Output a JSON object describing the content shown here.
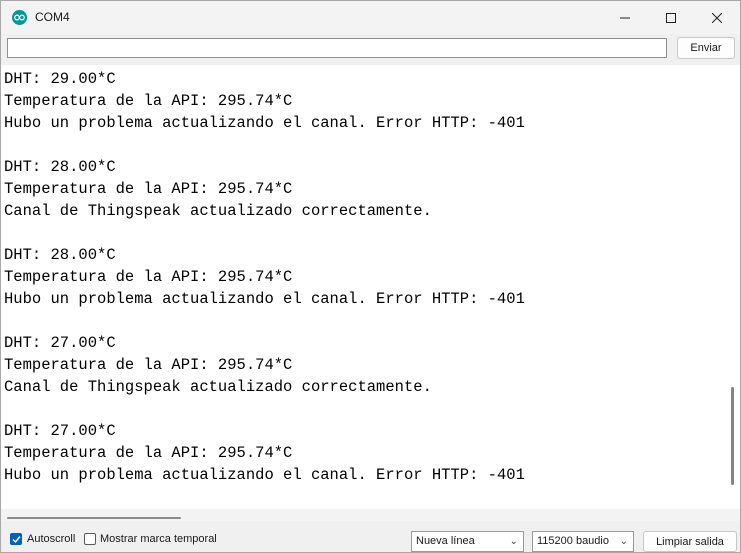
{
  "window": {
    "title": "COM4"
  },
  "send": {
    "input_value": "",
    "button_label": "Enviar"
  },
  "output": {
    "lines": [
      "DHT: 29.00*C",
      "Temperatura de la API: 295.74*C",
      "Hubo un problema actualizando el canal. Error HTTP: -401",
      "",
      "DHT: 28.00*C",
      "Temperatura de la API: 295.74*C",
      "Canal de Thingspeak actualizado correctamente.",
      "",
      "DHT: 28.00*C",
      "Temperatura de la API: 295.74*C",
      "Hubo un problema actualizando el canal. Error HTTP: -401",
      "",
      "DHT: 27.00*C",
      "Temperatura de la API: 295.74*C",
      "Canal de Thingspeak actualizado correctamente.",
      "",
      "DHT: 27.00*C",
      "Temperatura de la API: 295.74*C",
      "Hubo un problema actualizando el canal. Error HTTP: -401"
    ]
  },
  "bottom": {
    "autoscroll_label": "Autoscroll",
    "autoscroll_checked": true,
    "timestamp_label": "Mostrar marca temporal",
    "timestamp_checked": false,
    "line_ending": "Nueva línea",
    "baud_rate": "115200 baudio",
    "clear_label": "Limpiar salida"
  },
  "colors": {
    "accent": "#0060c0",
    "app_icon": "#00979c"
  },
  "icons": [
    "arduino-icon",
    "minimize-icon",
    "maximize-icon",
    "close-icon",
    "check-icon",
    "chevron-down-icon"
  ]
}
